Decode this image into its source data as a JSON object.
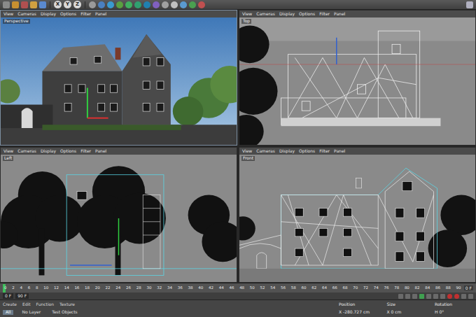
{
  "toolbar": {
    "axis_buttons": [
      "X",
      "Y",
      "Z"
    ]
  },
  "viewports": [
    {
      "label": "Perspective",
      "kind": "perspective",
      "selected": true,
      "menu": [
        "View",
        "Cameras",
        "Display",
        "Options",
        "Filter",
        "Panel"
      ]
    },
    {
      "label": "Top",
      "kind": "top",
      "selected": false,
      "menu": [
        "View",
        "Cameras",
        "Display",
        "Options",
        "Filter",
        "Panel"
      ]
    },
    {
      "label": "Left",
      "kind": "left",
      "selected": false,
      "menu": [
        "View",
        "Cameras",
        "Display",
        "Options",
        "Filter",
        "Panel"
      ]
    },
    {
      "label": "Front",
      "kind": "front",
      "selected": false,
      "menu": [
        "View",
        "Cameras",
        "Display",
        "Options",
        "Filter",
        "Panel"
      ]
    }
  ],
  "timeline": {
    "ticks": [
      "0",
      "2",
      "4",
      "6",
      "8",
      "10",
      "12",
      "14",
      "16",
      "18",
      "20",
      "22",
      "24",
      "26",
      "28",
      "30",
      "32",
      "34",
      "36",
      "38",
      "40",
      "42",
      "44",
      "46",
      "48",
      "50",
      "52",
      "54",
      "56",
      "58",
      "60",
      "62",
      "64",
      "66",
      "68",
      "70",
      "72",
      "74",
      "76",
      "78",
      "80",
      "82",
      "84",
      "86",
      "88",
      "90"
    ],
    "current": "0 F",
    "level": 0,
    "start": "0 F",
    "end": "90 F"
  },
  "bottom": {
    "menu": [
      "Create",
      "Edit",
      "Function",
      "Texture"
    ],
    "layers": [
      {
        "label": "All",
        "selected": true
      },
      {
        "label": "No Layer",
        "selected": false
      },
      {
        "label": "Test Objects",
        "selected": false
      }
    ],
    "coord_headers": [
      "Position",
      "Size",
      "Rotation"
    ],
    "coord_values": [
      "X -280.727 cm",
      "X 0 cm",
      "H 0°"
    ]
  }
}
